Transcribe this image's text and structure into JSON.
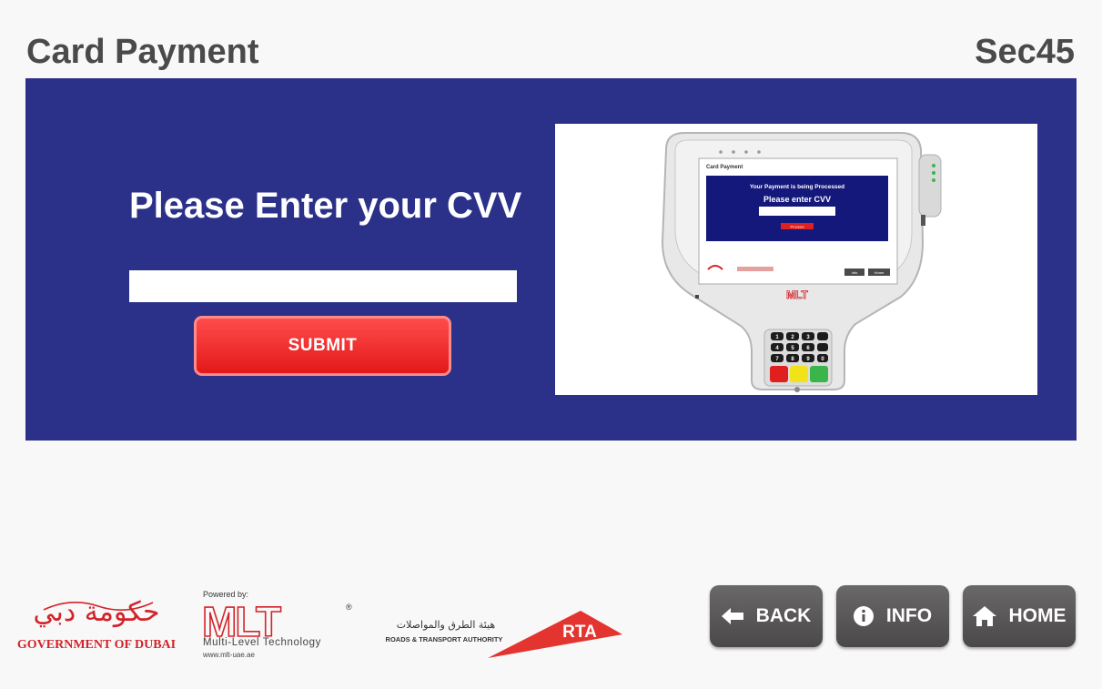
{
  "header": {
    "title": "Card Payment",
    "counter": "Sec45"
  },
  "main": {
    "prompt": "Please Enter your CVV",
    "cvv_value": "",
    "submit_label": "SUBMIT",
    "illustration": {
      "screen_title": "Card Payment",
      "processing_text": "Your Payment is being Processed",
      "enter_cvv_text": "Please enter CVV",
      "button_text": "Proceed",
      "info_text": "Info",
      "home_text": "Home",
      "brand": "MLT",
      "keypad_keys": [
        "1",
        "2",
        "3",
        "4",
        "5",
        "6",
        "7",
        "8",
        "9",
        "0"
      ]
    }
  },
  "footer": {
    "gov_logo": {
      "arabic": "حكومة دبي",
      "english": "GOVERNMENT OF DUBAI"
    },
    "mlt_logo": {
      "powered_by": "Powered by:",
      "brand": "MLT",
      "registered": "®",
      "tagline": "Multi-Level Technology",
      "url": "www.mlt-uae.ae"
    },
    "rta_logo": {
      "arabic": "هيئة الطرق والمواصلات",
      "english": "ROADS & TRANSPORT AUTHORITY",
      "brand": "RTA"
    },
    "nav": {
      "back_label": "BACK",
      "info_label": "INFO",
      "home_label": "HOME"
    }
  },
  "colors": {
    "panel": "#2b3189",
    "submit": "#e31818",
    "nav_button": "#555353",
    "title_text": "#4a4a4a",
    "gov_red": "#d2232a",
    "rta_red": "#e3342f"
  }
}
